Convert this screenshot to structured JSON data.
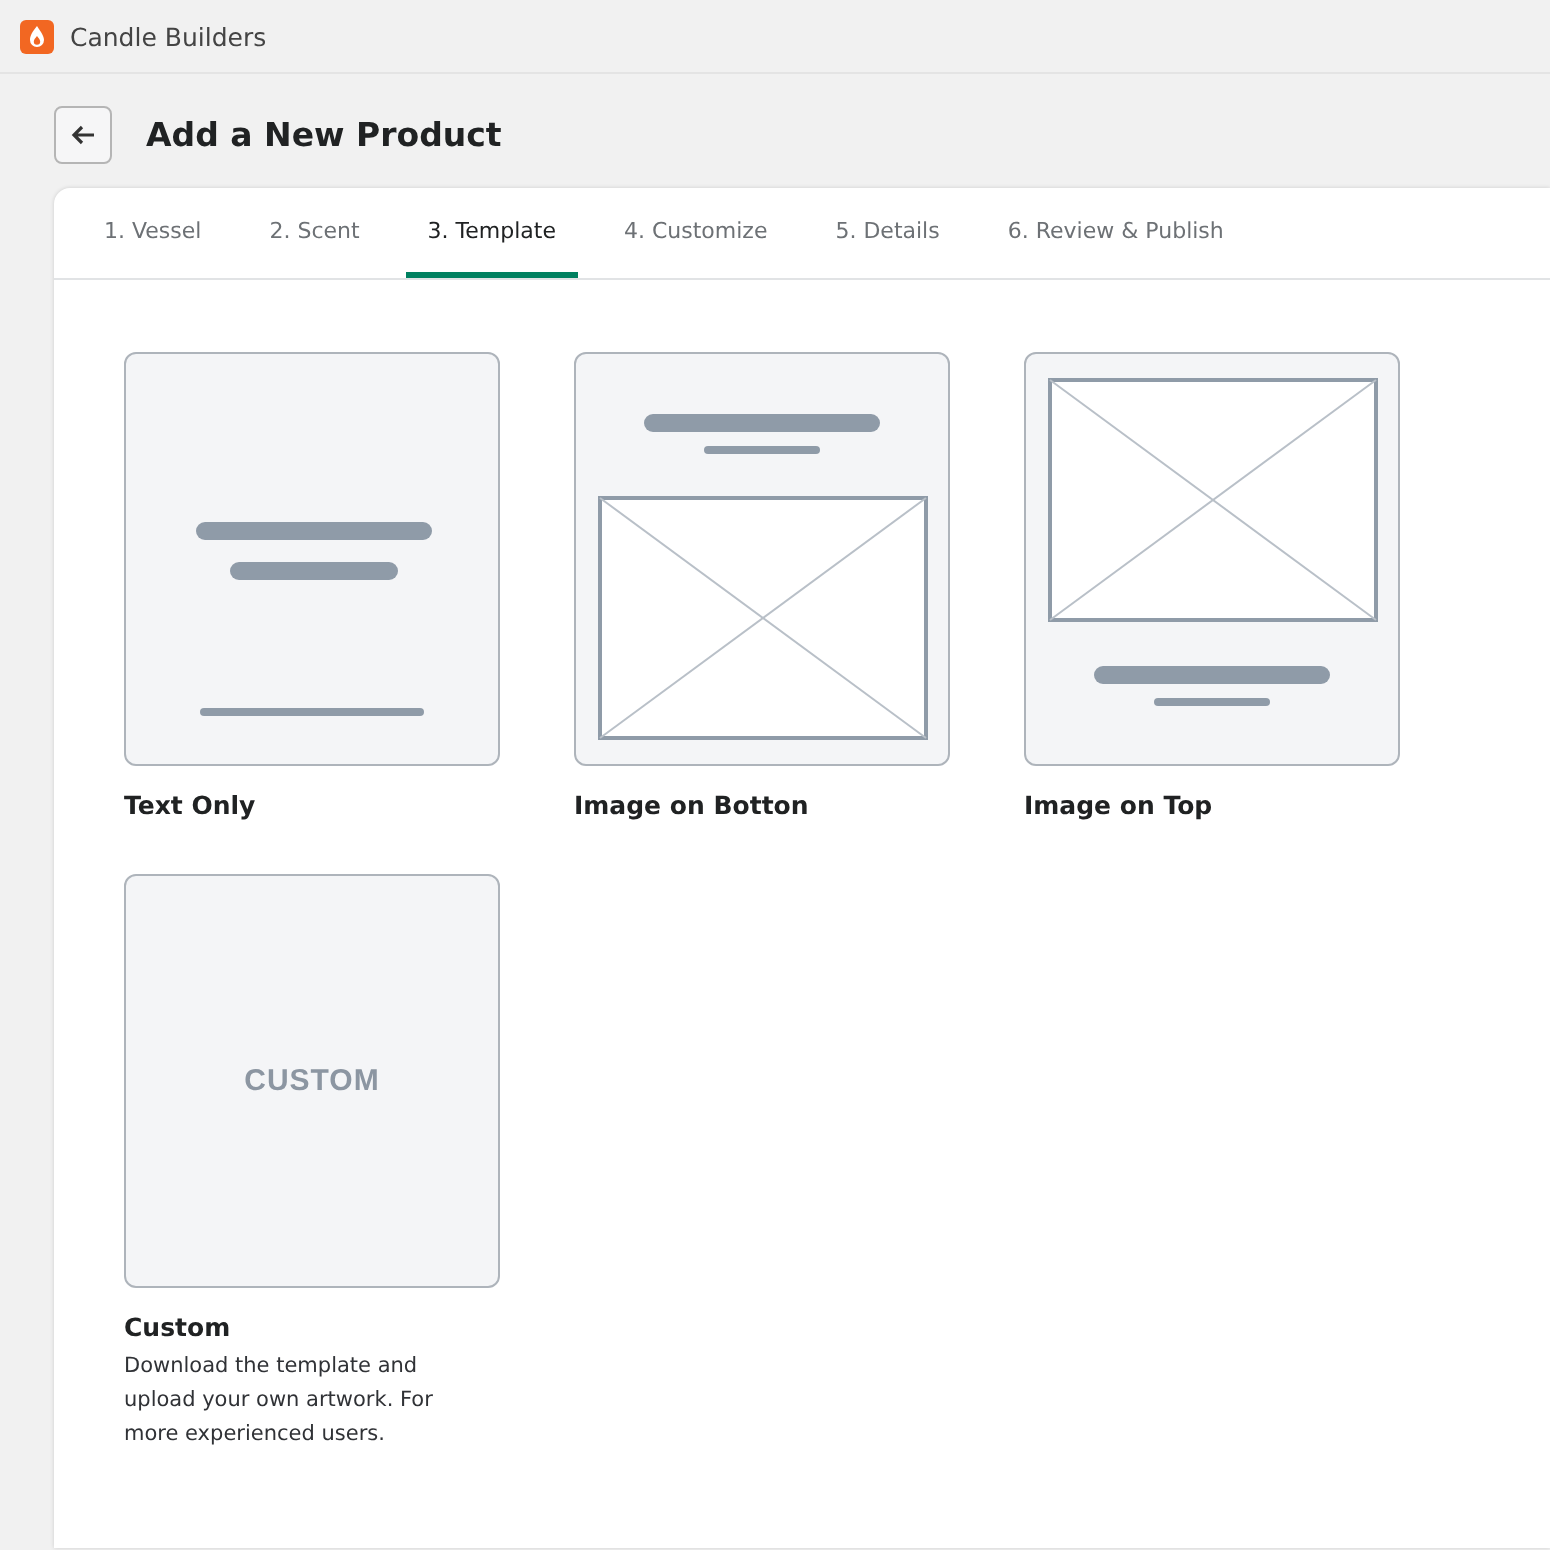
{
  "app": {
    "title": "Candle Builders"
  },
  "header": {
    "title": "Add a New Product"
  },
  "tabs": [
    {
      "label": "1. Vessel",
      "selected": false
    },
    {
      "label": "2. Scent",
      "selected": false
    },
    {
      "label": "3. Template",
      "selected": true
    },
    {
      "label": "4. Customize",
      "selected": false
    },
    {
      "label": "5. Details",
      "selected": false
    },
    {
      "label": "6. Review & Publish",
      "selected": false
    }
  ],
  "templates": [
    {
      "kind": "text_only",
      "name": "Text Only"
    },
    {
      "kind": "image_bottom",
      "name": "Image on Botton"
    },
    {
      "kind": "image_top",
      "name": "Image on Top"
    },
    {
      "kind": "custom",
      "name": "Custom",
      "thumbnail_text": "CUSTOM",
      "description": "Download the template and upload your own artwork. For more experienced users."
    }
  ]
}
